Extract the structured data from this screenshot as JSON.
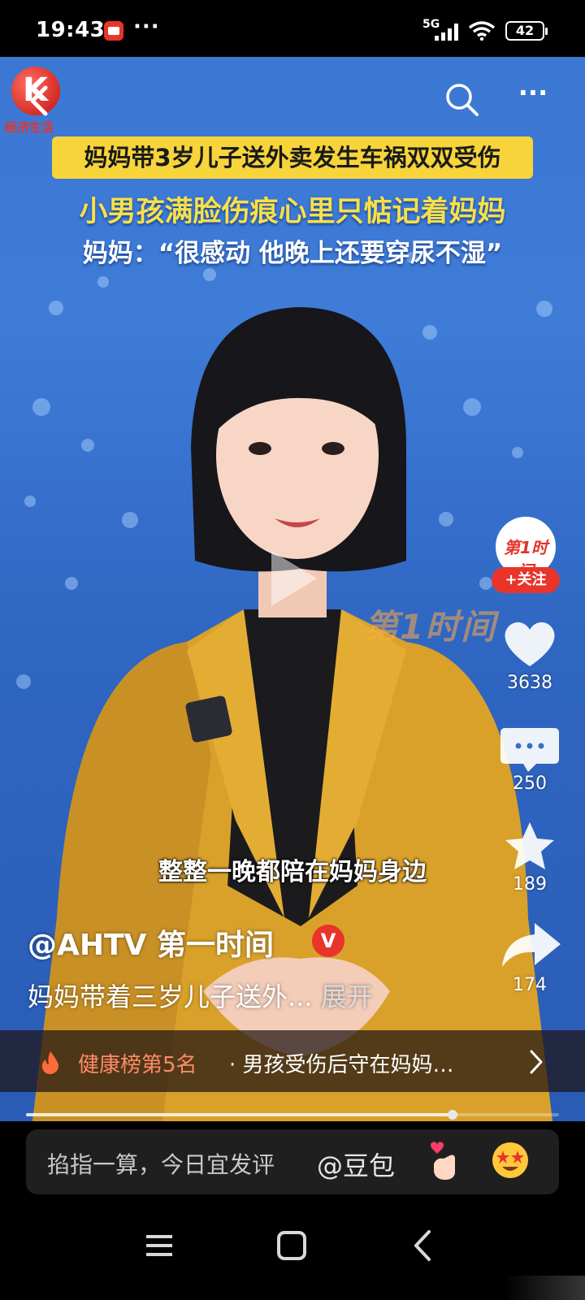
{
  "status_bar": {
    "time": "19:43",
    "overflow": "···",
    "network": "5G",
    "battery": "42"
  },
  "header": {
    "logo_label": "经济生活",
    "search_icon": "search-icon",
    "more_label": "···"
  },
  "video": {
    "headline": "妈妈带3岁儿子送外卖发生车祸双双受伤",
    "subhead_1": "小男孩满脸伤痕心里只惦记着妈妈",
    "subhead_2": "妈妈：“很感动 他晚上还要穿尿不湿”",
    "watermark": "第1时间",
    "caption": "整整一晚都陪在妈妈身边",
    "author": "@AHTV 第一时间",
    "verified_mark": "V",
    "description": "妈妈带着三岁儿子送外...",
    "description_more": "展开",
    "progress": 0.8
  },
  "rail": {
    "avatar_label": "第1时间",
    "follow_label": "+关注",
    "like_count": "3638",
    "comment_count": "250",
    "favorite_count": "189",
    "share_count": "174"
  },
  "trending": {
    "rank": "健康榜第5名",
    "topic": "· 男孩受伤后守在妈妈…"
  },
  "comment_bar": {
    "placeholder": "掐指一算，今日宜发评",
    "mention": "@豆包"
  },
  "colors": {
    "accent_red": "#e8342a",
    "headline_yellow": "#f7d43a",
    "subhead_yellow": "#f7e04a",
    "rank_orange": "#ff8a66"
  }
}
